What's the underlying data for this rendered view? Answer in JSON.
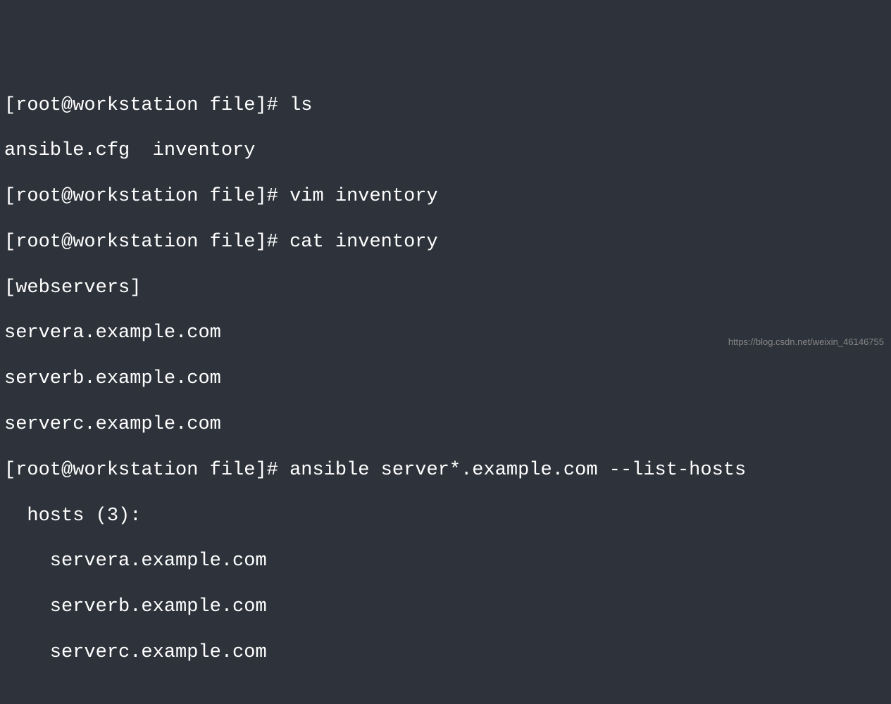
{
  "terminal": {
    "lines": [
      "[root@workstation file]# ls",
      "ansible.cfg  inventory",
      "[root@workstation file]# vim inventory",
      "[root@workstation file]# cat inventory",
      "[webservers]",
      "servera.example.com",
      "serverb.example.com",
      "serverc.example.com",
      "[root@workstation file]# ansible server*.example.com --list-hosts",
      "  hosts (3):",
      "    servera.example.com",
      "    serverb.example.com",
      "    serverc.example.com"
    ]
  },
  "watermark": "https://blog.csdn.net/weixin_46146755"
}
